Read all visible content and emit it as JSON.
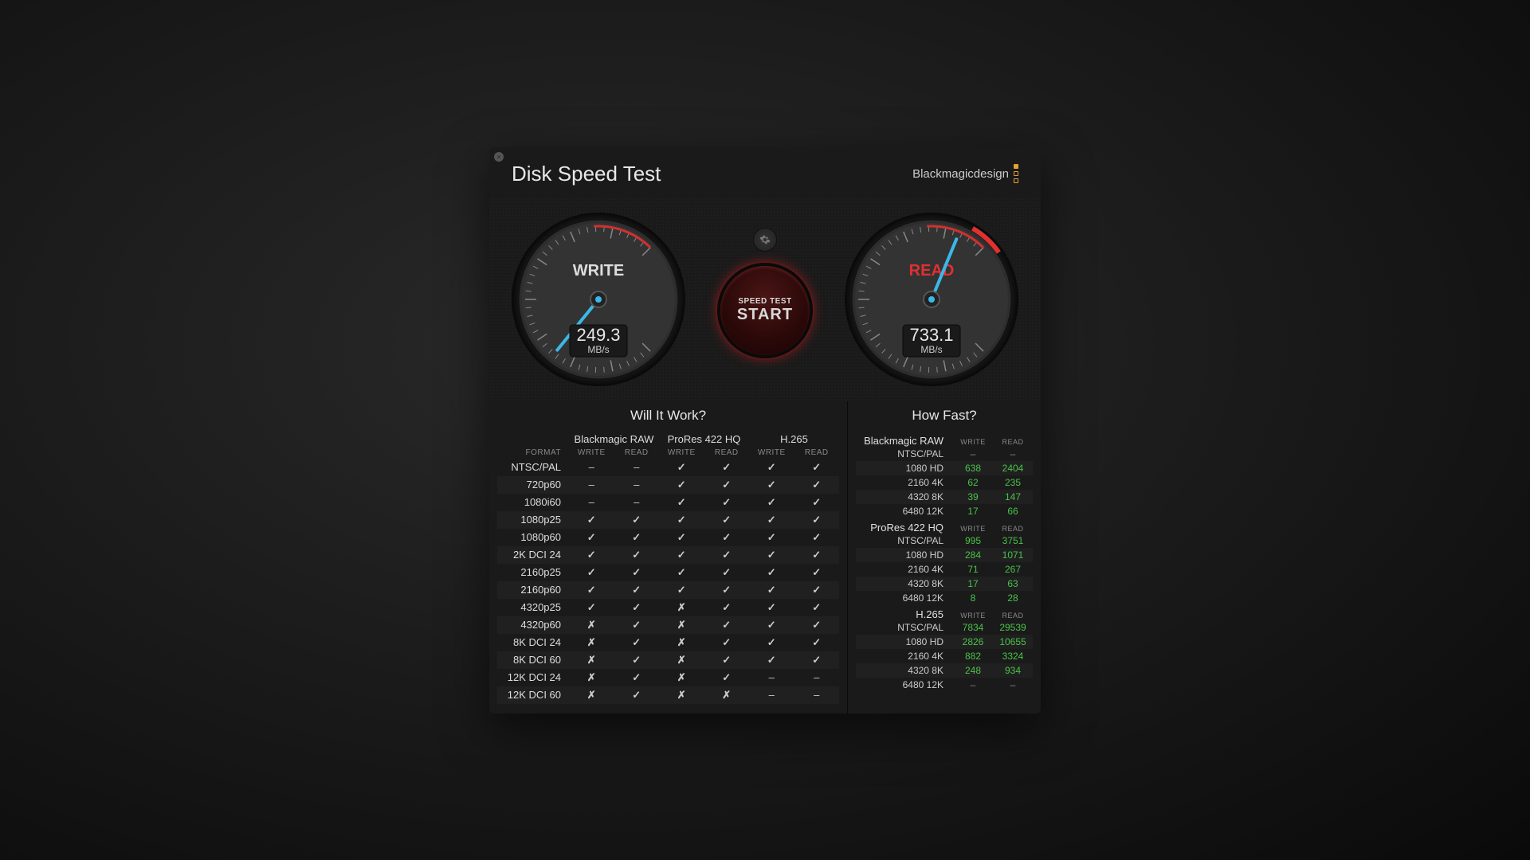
{
  "app": {
    "title": "Disk Speed Test",
    "brand": "Blackmagicdesign"
  },
  "gauges": {
    "write": {
      "label": "WRITE",
      "value": "249.3",
      "unit": "MB/s",
      "max": 800
    },
    "read": {
      "label": "READ",
      "value": "733.1",
      "unit": "MB/s",
      "max": 800
    }
  },
  "start_button": {
    "line1": "SPEED TEST",
    "line2": "START"
  },
  "will_panel": {
    "title": "Will It Work?",
    "codecs": [
      "Blackmagic RAW",
      "ProRes 422 HQ",
      "H.265"
    ],
    "format_label": "FORMAT",
    "write_label": "WRITE",
    "read_label": "READ",
    "rows": [
      {
        "format": "NTSC/PAL",
        "cells": [
          "dash",
          "dash",
          "check",
          "check",
          "check",
          "check"
        ]
      },
      {
        "format": "720p60",
        "cells": [
          "dash",
          "dash",
          "check",
          "check",
          "check",
          "check"
        ]
      },
      {
        "format": "1080i60",
        "cells": [
          "dash",
          "dash",
          "check",
          "check",
          "check",
          "check"
        ]
      },
      {
        "format": "1080p25",
        "cells": [
          "check",
          "check",
          "check",
          "check",
          "check",
          "check"
        ]
      },
      {
        "format": "1080p60",
        "cells": [
          "check",
          "check",
          "check",
          "check",
          "check",
          "check"
        ]
      },
      {
        "format": "2K DCI 24",
        "cells": [
          "check",
          "check",
          "check",
          "check",
          "check",
          "check"
        ]
      },
      {
        "format": "2160p25",
        "cells": [
          "check",
          "check",
          "check",
          "check",
          "check",
          "check"
        ]
      },
      {
        "format": "2160p60",
        "cells": [
          "check",
          "check",
          "check",
          "check",
          "check",
          "check"
        ]
      },
      {
        "format": "4320p25",
        "cells": [
          "check",
          "check",
          "cross",
          "check",
          "check",
          "check"
        ]
      },
      {
        "format": "4320p60",
        "cells": [
          "cross",
          "check",
          "cross",
          "check",
          "check",
          "check"
        ]
      },
      {
        "format": "8K DCI 24",
        "cells": [
          "cross",
          "check",
          "cross",
          "check",
          "check",
          "check"
        ]
      },
      {
        "format": "8K DCI 60",
        "cells": [
          "cross",
          "check",
          "cross",
          "check",
          "check",
          "check"
        ]
      },
      {
        "format": "12K DCI 24",
        "cells": [
          "cross",
          "check",
          "cross",
          "check",
          "dash",
          "dash"
        ]
      },
      {
        "format": "12K DCI 60",
        "cells": [
          "cross",
          "check",
          "cross",
          "cross",
          "dash",
          "dash"
        ]
      }
    ]
  },
  "fast_panel": {
    "title": "How Fast?",
    "write_label": "WRITE",
    "read_label": "READ",
    "groups": [
      {
        "codec": "Blackmagic RAW",
        "rows": [
          {
            "fmt": "NTSC/PAL",
            "write": "–",
            "read": "–"
          },
          {
            "fmt": "1080 HD",
            "write": "638",
            "read": "2404"
          },
          {
            "fmt": "2160 4K",
            "write": "62",
            "read": "235"
          },
          {
            "fmt": "4320 8K",
            "write": "39",
            "read": "147"
          },
          {
            "fmt": "6480 12K",
            "write": "17",
            "read": "66"
          }
        ]
      },
      {
        "codec": "ProRes 422 HQ",
        "rows": [
          {
            "fmt": "NTSC/PAL",
            "write": "995",
            "read": "3751"
          },
          {
            "fmt": "1080 HD",
            "write": "284",
            "read": "1071"
          },
          {
            "fmt": "2160 4K",
            "write": "71",
            "read": "267"
          },
          {
            "fmt": "4320 8K",
            "write": "17",
            "read": "63"
          },
          {
            "fmt": "6480 12K",
            "write": "8",
            "read": "28"
          }
        ]
      },
      {
        "codec": "H.265",
        "rows": [
          {
            "fmt": "NTSC/PAL",
            "write": "7834",
            "read": "29539"
          },
          {
            "fmt": "1080 HD",
            "write": "2826",
            "read": "10655"
          },
          {
            "fmt": "2160 4K",
            "write": "882",
            "read": "3324"
          },
          {
            "fmt": "4320 8K",
            "write": "248",
            "read": "934"
          },
          {
            "fmt": "6480 12K",
            "write": "–",
            "read": "–"
          }
        ]
      }
    ]
  }
}
